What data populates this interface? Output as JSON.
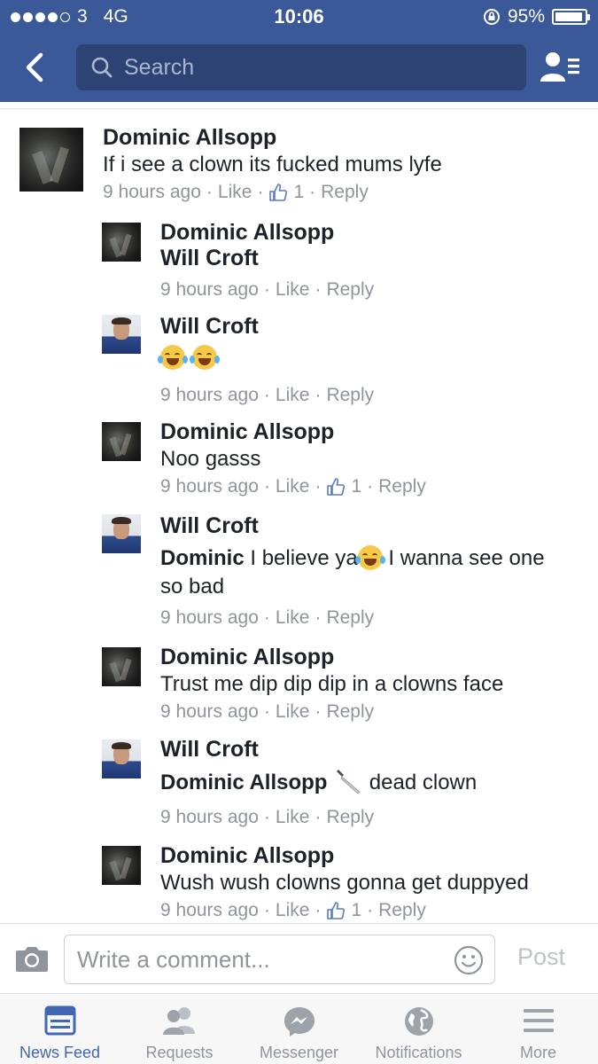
{
  "status_bar": {
    "carrier": "3",
    "network": "4G",
    "time": "10:06",
    "battery": "95%",
    "battery_level": 0.95
  },
  "nav": {
    "search_placeholder": "Search"
  },
  "comments": [
    {
      "author": "Dominic Allsopp",
      "text": "If i see a clown its fucked mums lyfe",
      "time": "9 hours ago",
      "like": "Like",
      "likes": "1",
      "reply": "Reply"
    }
  ],
  "replies": [
    {
      "author": "Dominic Allsopp",
      "mention": "Will Croft",
      "time": "9 hours ago",
      "like": "Like",
      "reply": "Reply"
    },
    {
      "author": "Will Croft",
      "emoji": "joy joy",
      "time": "9 hours ago",
      "like": "Like",
      "reply": "Reply"
    },
    {
      "author": "Dominic Allsopp",
      "text": "Noo gasss",
      "time": "9 hours ago",
      "like": "Like",
      "likes": "1",
      "reply": "Reply"
    },
    {
      "author": "Will Croft",
      "mention": "Dominic",
      "text_a": "I believe ya",
      "text_b": " I wanna see one",
      "text_c": "so bad",
      "time": "9 hours ago",
      "like": "Like",
      "reply": "Reply"
    },
    {
      "author": "Dominic Allsopp",
      "text": "Trust me dip dip dip in a clowns face",
      "time": "9 hours ago",
      "like": "Like",
      "reply": "Reply"
    },
    {
      "author": "Will Croft",
      "mention": "Dominic Allsopp",
      "text": "dead clown",
      "time": "9 hours ago",
      "like": "Like",
      "reply": "Reply"
    },
    {
      "author": "Dominic Allsopp",
      "text": "Wush wush clowns gonna get duppyed",
      "time": "9 hours ago",
      "like": "Like",
      "likes": "1",
      "reply": "Reply"
    }
  ],
  "composer": {
    "placeholder": "Write a comment...",
    "post": "Post"
  },
  "tabs": [
    {
      "label": "News Feed",
      "icon": "news-feed-icon",
      "active": true
    },
    {
      "label": "Requests",
      "icon": "requests-icon",
      "active": false
    },
    {
      "label": "Messenger",
      "icon": "messenger-icon",
      "active": false
    },
    {
      "label": "Notifications",
      "icon": "globe-icon",
      "active": false
    },
    {
      "label": "More",
      "icon": "menu-icon",
      "active": false
    }
  ],
  "colors": {
    "brand": "#3b5998",
    "meta": "#90949c",
    "active_tab": "#4267b2"
  }
}
